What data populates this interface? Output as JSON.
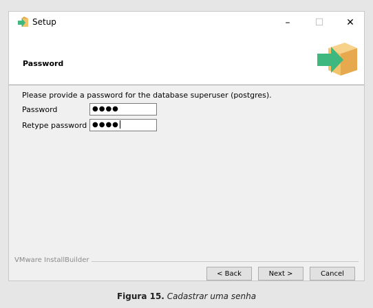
{
  "window": {
    "title": "Setup",
    "controls": {
      "minimize": "–",
      "maximize": "☐",
      "close": "✕"
    }
  },
  "header": {
    "title": "Password",
    "icon": "installer-box-arrow-icon"
  },
  "form": {
    "prompt": "Please provide a password for the database superuser (postgres).",
    "password_label": "Password",
    "password_value": "●●●●",
    "retype_label": "Retype password",
    "retype_value": "●●●●"
  },
  "footer": {
    "vendor": "VMware InstallBuilder",
    "back_label": "< Back",
    "next_label": "Next >",
    "cancel_label": "Cancel"
  },
  "caption": {
    "figure": "Figura 15.",
    "text": "Cadastrar uma senha"
  },
  "colors": {
    "window_bg": "#f0f0f0",
    "header_bg": "#ffffff",
    "icon_green": "#3fb87f",
    "icon_box": "#f2c36b"
  }
}
